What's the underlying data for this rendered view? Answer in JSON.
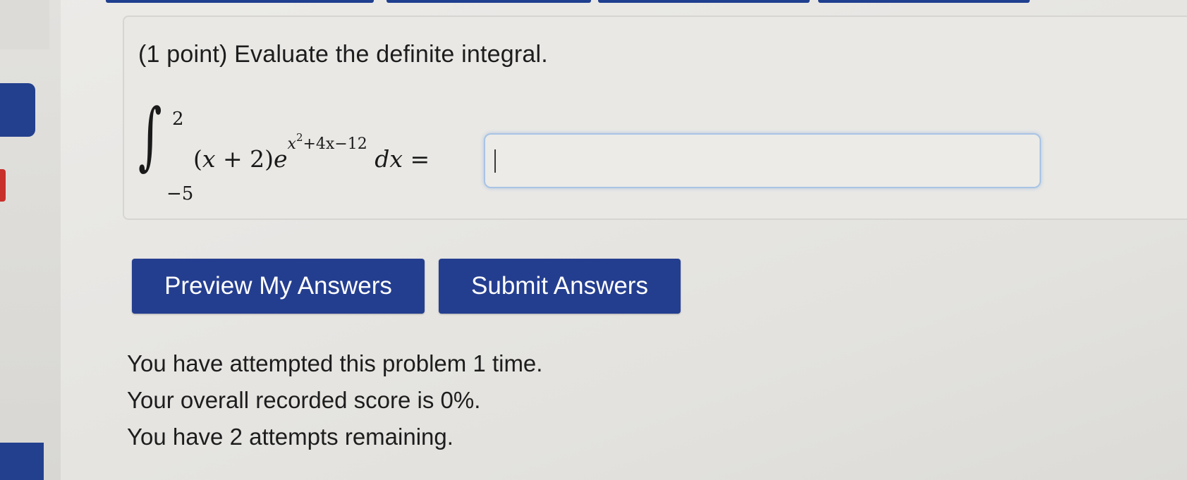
{
  "problem": {
    "title": "(1 point) Evaluate the definite integral.",
    "integral": {
      "upper_limit": "2",
      "lower_limit": "−5",
      "open_paren": "(",
      "var_x": "x",
      "plus_two": " + 2)",
      "e": "e",
      "exp_x": "x",
      "exp_square": "2",
      "exp_rest": "+4x−12",
      "dx": "dx",
      "equals": "="
    },
    "answer": {
      "value": "",
      "placeholder": ""
    }
  },
  "buttons": {
    "preview_label": "Preview My Answers",
    "submit_label": "Submit Answers"
  },
  "status": {
    "attempts": "You have attempted this problem 1 time.",
    "score": "Your overall recorded score is 0%.",
    "remaining": "You have 2 attempts remaining."
  },
  "colors": {
    "button_bg": "#243e8f",
    "button_text": "#ffffff",
    "input_focus_border": "#a9c4e4",
    "sidebar_tab": "#23408e",
    "alert_red": "#c8302c"
  }
}
